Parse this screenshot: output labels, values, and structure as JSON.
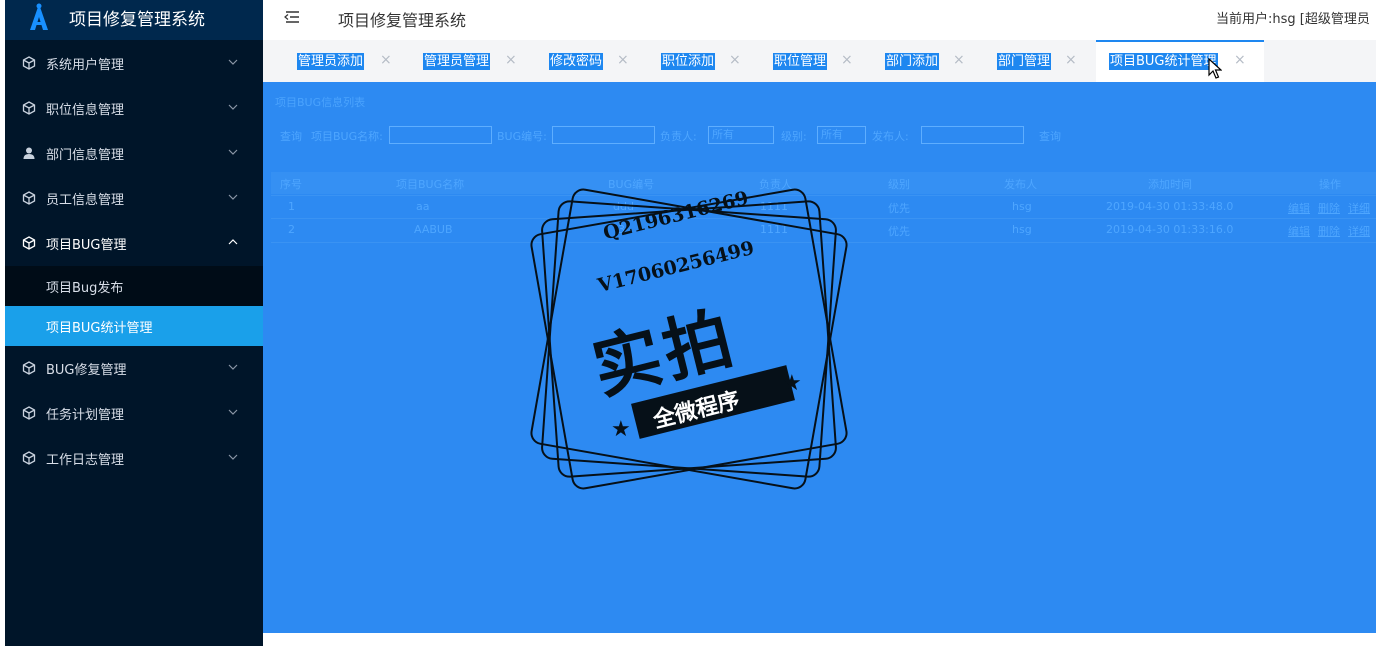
{
  "app": {
    "title": "项目修复管理系统"
  },
  "topbar": {
    "title": "项目修复管理系统",
    "user_info": "当前用户:hsg [超级管理员"
  },
  "sidebar": {
    "items": [
      {
        "label": "系统用户管理",
        "icon": "cube-icon"
      },
      {
        "label": "职位信息管理",
        "icon": "cube-icon"
      },
      {
        "label": "部门信息管理",
        "icon": "user-icon"
      },
      {
        "label": "员工信息管理",
        "icon": "cube-icon"
      },
      {
        "label": "项目BUG管理",
        "icon": "cube-icon",
        "expanded": true
      },
      {
        "label": "BUG修复管理",
        "icon": "cube-icon"
      },
      {
        "label": "任务计划管理",
        "icon": "cube-icon"
      },
      {
        "label": "工作日志管理",
        "icon": "cube-icon"
      }
    ],
    "subitems": [
      {
        "label": "项目Bug发布",
        "active": false
      },
      {
        "label": "项目BUG统计管理",
        "active": true
      }
    ]
  },
  "tabs": [
    {
      "label": "管理员添加"
    },
    {
      "label": "管理员管理"
    },
    {
      "label": "修改密码"
    },
    {
      "label": "职位添加"
    },
    {
      "label": "职位管理"
    },
    {
      "label": "部门添加"
    },
    {
      "label": "部门管理"
    },
    {
      "label": "项目BUG统计管理",
      "active": true
    }
  ],
  "tab_close_glyph": "×",
  "content": {
    "title": "项目BUG信息列表",
    "search": {
      "query_label": "查询",
      "name_label": "项目BUG名称:",
      "code_label": "BUG编号:",
      "owner_label": "负责人:",
      "owner_value": "所有",
      "level_label": "级别:",
      "level_value": "所有",
      "publisher_label": "发布人:",
      "query_button": "查询"
    },
    "table": {
      "headers": [
        "序号",
        "项目BUG名称",
        "BUG编号",
        "负责人",
        "级别",
        "发布人",
        "添加时间",
        "操作"
      ],
      "rows": [
        {
          "index": "1",
          "name": "aa",
          "code": "ddd",
          "owner": "1111",
          "level": "优先",
          "publisher": "hsg",
          "time": "2019-04-30 01:33:48.0"
        },
        {
          "index": "2",
          "name": "AABUB",
          "code": "3",
          "owner": "1111",
          "level": "优先",
          "publisher": "hsg",
          "time": "2019-04-30 01:33:16.0"
        }
      ],
      "actions": [
        "编辑",
        "删除",
        "详细"
      ]
    }
  },
  "watermark": {
    "line1": "Q2196316269",
    "line2": "V17060256499",
    "big": "实拍",
    "ribbon": "全微程序"
  },
  "colors": {
    "sidebar_bg": "#001529",
    "active_sub": "#1aa0ea",
    "content_bg": "#2d8af2",
    "tab_accent": "#1e87f0"
  }
}
